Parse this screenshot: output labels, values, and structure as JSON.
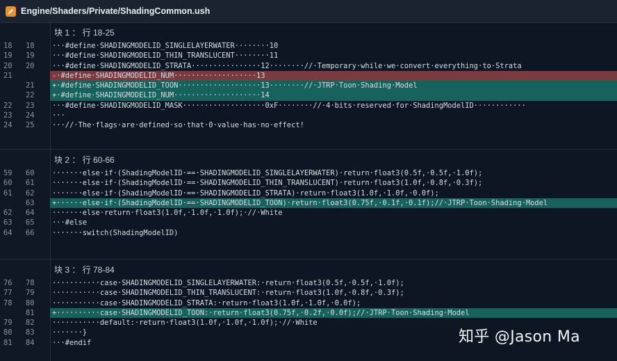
{
  "title": {
    "path": "Engine/Shaders/Private/ShadingCommon.ush"
  },
  "hunks": [
    {
      "header": "块 1 ： 行 18-25",
      "lines": [
        {
          "type": "ctx",
          "old": "18",
          "new": "18",
          "code": "···#define·SHADINGMODELID_SINGLELAYERWATER········10"
        },
        {
          "type": "ctx",
          "old": "19",
          "new": "19",
          "code": "···#define·SHADINGMODELID_THIN_TRANSLUCENT········11"
        },
        {
          "type": "ctx",
          "old": "20",
          "new": "20",
          "code": "···#define·SHADINGMODELID_STRATA················12········//·Temporary·while·we·convert·everything·to·Strata"
        },
        {
          "type": "del",
          "old": "21",
          "new": "",
          "code": "-·#define·SHADINGMODELID_NUM···················13"
        },
        {
          "type": "add",
          "old": "",
          "new": "21",
          "code": "+·#define·SHADINGMODELID_TOON···················13········//·JTRP·Toon·Shading·Model"
        },
        {
          "type": "add",
          "old": "",
          "new": "22",
          "code": "+·#define·SHADINGMODELID_NUM····················14"
        },
        {
          "type": "ctx",
          "old": "22",
          "new": "23",
          "code": "···#define·SHADINGMODELID_MASK···················0xF········//·4·bits·reserved·for·ShadingModelID············"
        },
        {
          "type": "ctx",
          "old": "23",
          "new": "24",
          "code": "···"
        },
        {
          "type": "ctx",
          "old": "24",
          "new": "25",
          "code": "···//·The·flags·are·defined·so·that·0·value·has·no·effect!"
        }
      ]
    },
    {
      "header": "块 2 ： 行 60-66",
      "lines": [
        {
          "type": "ctx",
          "old": "59",
          "new": "60",
          "code": "·······else·if·(ShadingModelID·==·SHADINGMODELID_SINGLELAYERWATER)·return·float3(0.5f,·0.5f,·1.0f);"
        },
        {
          "type": "ctx",
          "old": "60",
          "new": "61",
          "code": "·······else·if·(ShadingModelID·==·SHADINGMODELID_THIN_TRANSLUCENT)·return·float3(1.0f,·0.8f,·0.3f);"
        },
        {
          "type": "ctx",
          "old": "61",
          "new": "62",
          "code": "·······else·if·(ShadingModelID·==·SHADINGMODELID_STRATA)·return·float3(1.0f,·1.0f,·0.0f);"
        },
        {
          "type": "add",
          "old": "",
          "new": "63",
          "code": "+······else·if·(ShadingModelID·==·SHADINGMODELID_TOON)·return·float3(0.75f,·0.1f,·0.1f);//·JTRP·Toon·Shading·Model"
        },
        {
          "type": "ctx",
          "old": "62",
          "new": "64",
          "code": "·······else·return·float3(1.0f,·1.0f,·1.0f);·//·White"
        },
        {
          "type": "ctx",
          "old": "63",
          "new": "65",
          "code": "···#else"
        },
        {
          "type": "ctx",
          "old": "64",
          "new": "66",
          "code": "·······switch(ShadingModelID)"
        }
      ]
    },
    {
      "header": "块 3 ： 行 78-84",
      "lines": [
        {
          "type": "ctx",
          "old": "76",
          "new": "78",
          "code": "···········case·SHADINGMODELID_SINGLELAYERWATER:·return·float3(0.5f,·0.5f,·1.0f);"
        },
        {
          "type": "ctx",
          "old": "77",
          "new": "79",
          "code": "···········case·SHADINGMODELID_THIN_TRANSLUCENT:·return·float3(1.0f,·0.8f,·0.3f);"
        },
        {
          "type": "ctx",
          "old": "78",
          "new": "80",
          "code": "···········case·SHADINGMODELID_STRATA:·return·float3(1.0f,·1.0f,·0.0f);"
        },
        {
          "type": "add",
          "old": "",
          "new": "81",
          "code": "+··········case·SHADINGMODELID_TOON:·return·float3(0.75f,·0.2f,·0.0f);//·JTRP·Toon·Shading·Model"
        },
        {
          "type": "ctx",
          "old": "79",
          "new": "82",
          "code": "···········default:·return·float3(1.0f,·1.0f,·1.0f);·//·White"
        },
        {
          "type": "ctx",
          "old": "80",
          "new": "83",
          "code": "·······}"
        },
        {
          "type": "ctx",
          "old": "81",
          "new": "84",
          "code": "···#endif"
        }
      ]
    }
  ],
  "watermark": "知乎 @Jason Ma",
  "colors": {
    "deleted_line": "#7a3a3f",
    "added_line": "#17625d",
    "file_icon": "#e8912d"
  }
}
